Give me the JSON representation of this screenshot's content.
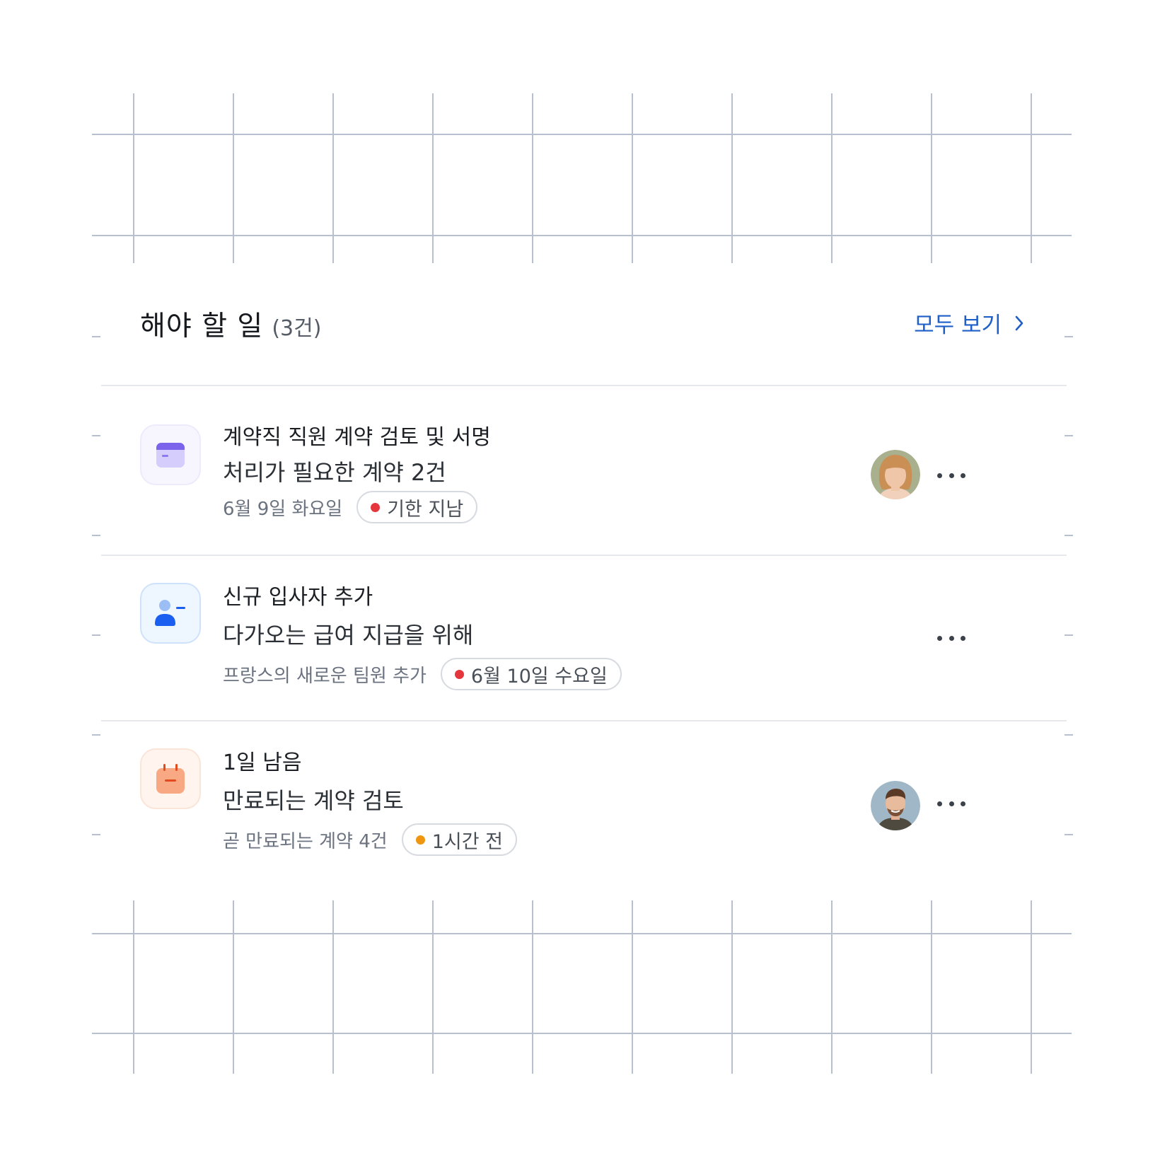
{
  "header": {
    "title": "해야 할 일",
    "count": "(3건)",
    "view_all": "모두 보기"
  },
  "tasks": [
    {
      "icon": "contract-card-icon",
      "title": "계약직 직원 계약 검토 및 서명",
      "subtitle": "처리가 필요한 계약 2건",
      "meta": "6월 9일 화요일",
      "badge": "기한 지남",
      "badge_dot_color": "#e5363d",
      "has_avatar": true
    },
    {
      "icon": "add-person-icon",
      "title": "신규 입사자 추가",
      "subtitle": "다가오는 급여 지급을 위해",
      "meta": "프랑스의 새로운 팀원 추가",
      "badge": "6월 10일 수요일",
      "badge_dot_color": "#e5363d",
      "has_avatar": false
    },
    {
      "icon": "calendar-icon",
      "title": "1일 남음",
      "subtitle": "만료되는 계약 검토",
      "meta": "곧 만료되는 계약 4건",
      "badge": "1시간 전",
      "badge_dot_color": "#f0950f",
      "has_avatar": true
    }
  ],
  "colors": {
    "accent": "#1f5fc8",
    "grid": "#b8c0cf"
  }
}
